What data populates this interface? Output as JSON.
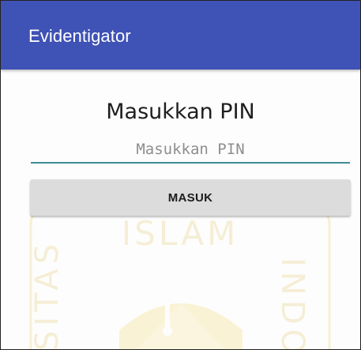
{
  "app_bar": {
    "title": "Evidentigator"
  },
  "main": {
    "heading": "Masukkan PIN",
    "pin_input": {
      "value": "",
      "placeholder": "Masukkan PIN"
    },
    "submit_label": "MASUK"
  },
  "watermark": {
    "text_top": "ISLAM",
    "text_left": "SITAS",
    "text_right": "INDO"
  },
  "colors": {
    "app_bar": "#3f52b5",
    "input_underline": "#3d8c98",
    "button_bg": "#dcdcdc",
    "watermark_gold": "#f2d66a"
  }
}
